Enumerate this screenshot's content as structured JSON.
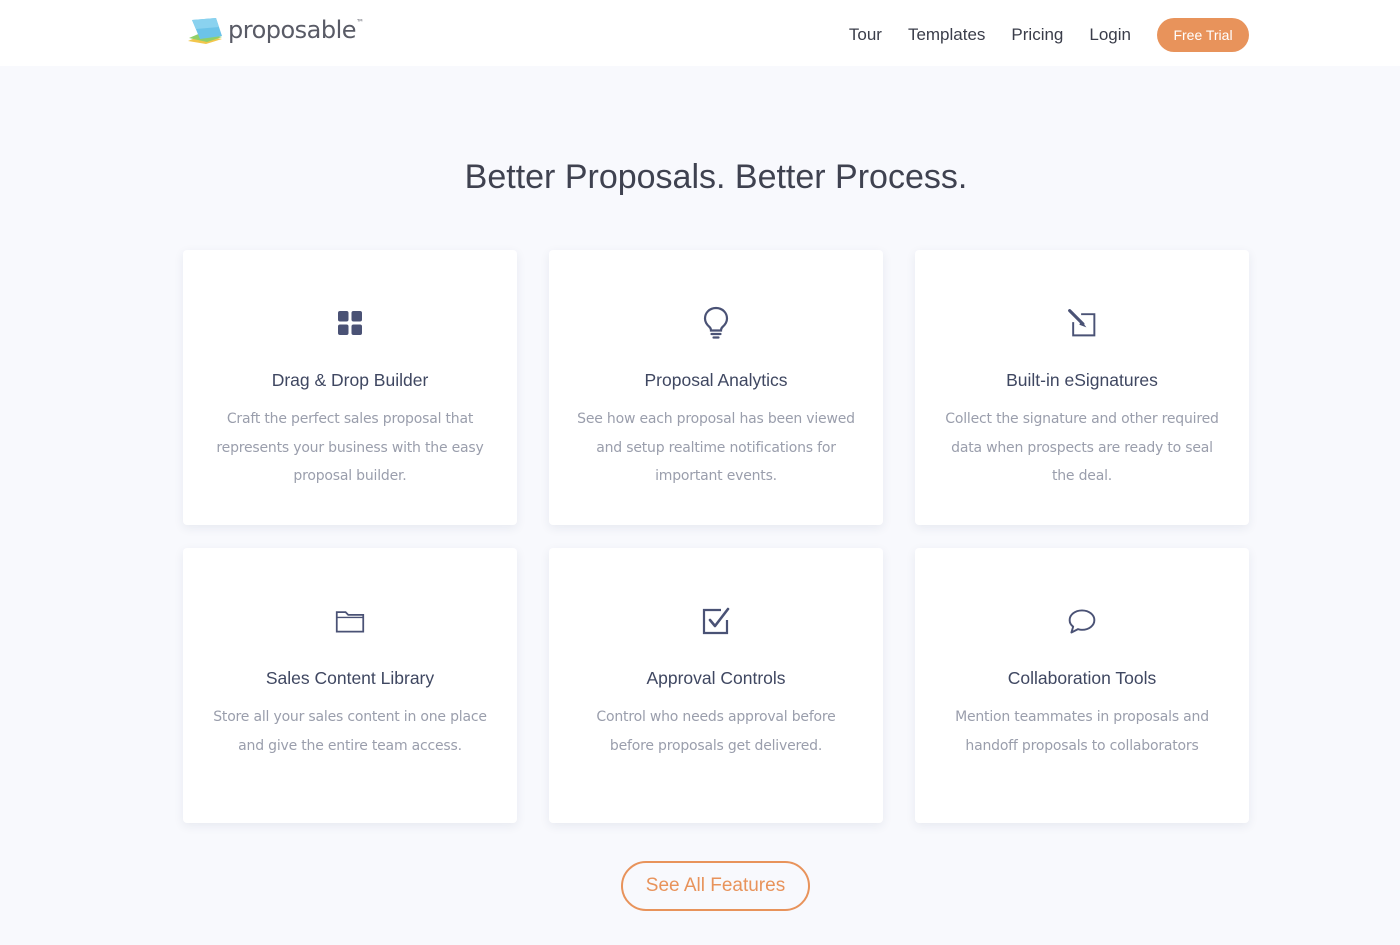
{
  "header": {
    "logo_text": "proposable",
    "logo_tm": "™",
    "nav": [
      {
        "label": "Tour"
      },
      {
        "label": "Templates"
      },
      {
        "label": "Pricing"
      },
      {
        "label": "Login"
      }
    ],
    "cta_label": "Free Trial"
  },
  "main": {
    "headline": "Better Proposals. Better Process.",
    "features": [
      {
        "icon": "grid-icon",
        "title": "Drag & Drop Builder",
        "description": "Craft the perfect sales proposal that represents your business with the easy proposal builder."
      },
      {
        "icon": "lightbulb-icon",
        "title": "Proposal Analytics",
        "description": "See how each proposal has been viewed and setup realtime notifications for important events."
      },
      {
        "icon": "pen-square-icon",
        "title": "Built-in eSignatures",
        "description": "Collect the signature and other required data when prospects are ready to seal the deal."
      },
      {
        "icon": "folder-icon",
        "title": "Sales Content Library",
        "description": "Store all your sales content in one place and give the entire team access."
      },
      {
        "icon": "checkbox-icon",
        "title": "Approval Controls",
        "description": "Control who needs approval before before proposals get delivered."
      },
      {
        "icon": "chat-bubble-icon",
        "title": "Collaboration Tools",
        "description": "Mention teammates in proposals and handoff proposals to collaborators"
      }
    ],
    "see_all_label": "See All Features"
  },
  "colors": {
    "accent": "#e8935b",
    "background": "#f8f9fd",
    "icon": "#4a5275",
    "title": "#3f4761",
    "body_text": "#9a9eac"
  }
}
